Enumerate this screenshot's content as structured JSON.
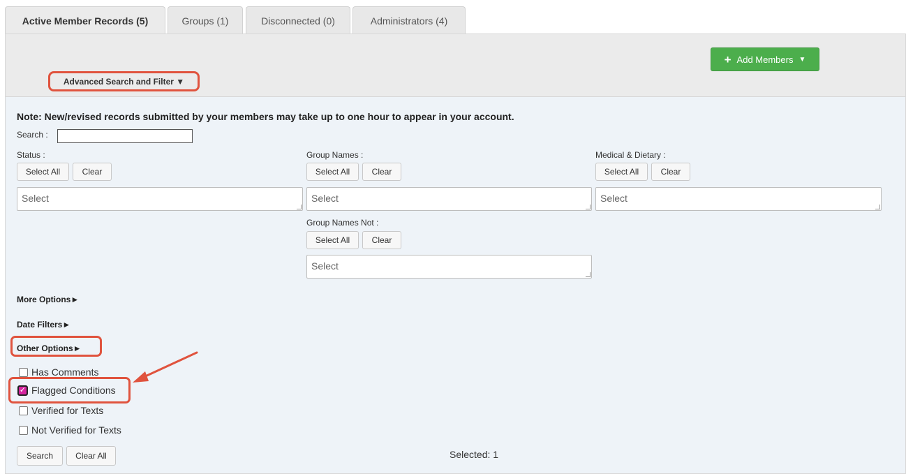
{
  "tabs": [
    {
      "label": "Active Member Records (5)",
      "active": true
    },
    {
      "label": "Groups (1)",
      "active": false
    },
    {
      "label": "Disconnected (0)",
      "active": false
    },
    {
      "label": "Administrators (4)",
      "active": false
    }
  ],
  "header": {
    "add_members": "Add Members",
    "advanced_search": "Advanced Search and Filter ▼"
  },
  "note": "Note: New/revised records submitted by your members may take up to one hour to appear in your account.",
  "search": {
    "label": "Search :",
    "value": ""
  },
  "filters": {
    "status": {
      "label": "Status :",
      "select_all": "Select All",
      "clear": "Clear",
      "placeholder": "Select"
    },
    "group_names": {
      "label": "Group Names :",
      "select_all": "Select All",
      "clear": "Clear",
      "placeholder": "Select"
    },
    "medical": {
      "label": "Medical & Dietary :",
      "select_all": "Select All",
      "clear": "Clear",
      "placeholder": "Select"
    },
    "group_names_not": {
      "label": "Group Names Not :",
      "select_all": "Select All",
      "clear": "Clear",
      "placeholder": "Select"
    }
  },
  "sections": {
    "more_options": "More Options►",
    "date_filters": "Date Filters►",
    "other_options": "Other Options►"
  },
  "checkboxes": [
    {
      "label": "Has Comments",
      "checked": false
    },
    {
      "label": "Flagged Conditions",
      "checked": true
    },
    {
      "label": "Verified for Texts",
      "checked": false
    },
    {
      "label": "Not Verified for Texts",
      "checked": false
    }
  ],
  "actions": {
    "search": "Search",
    "clear_all": "Clear All"
  },
  "selected_text": "Selected: 1",
  "colors": {
    "annotation": "#e0533e",
    "add_button": "#4cae4c",
    "checked": "#d6249f"
  }
}
